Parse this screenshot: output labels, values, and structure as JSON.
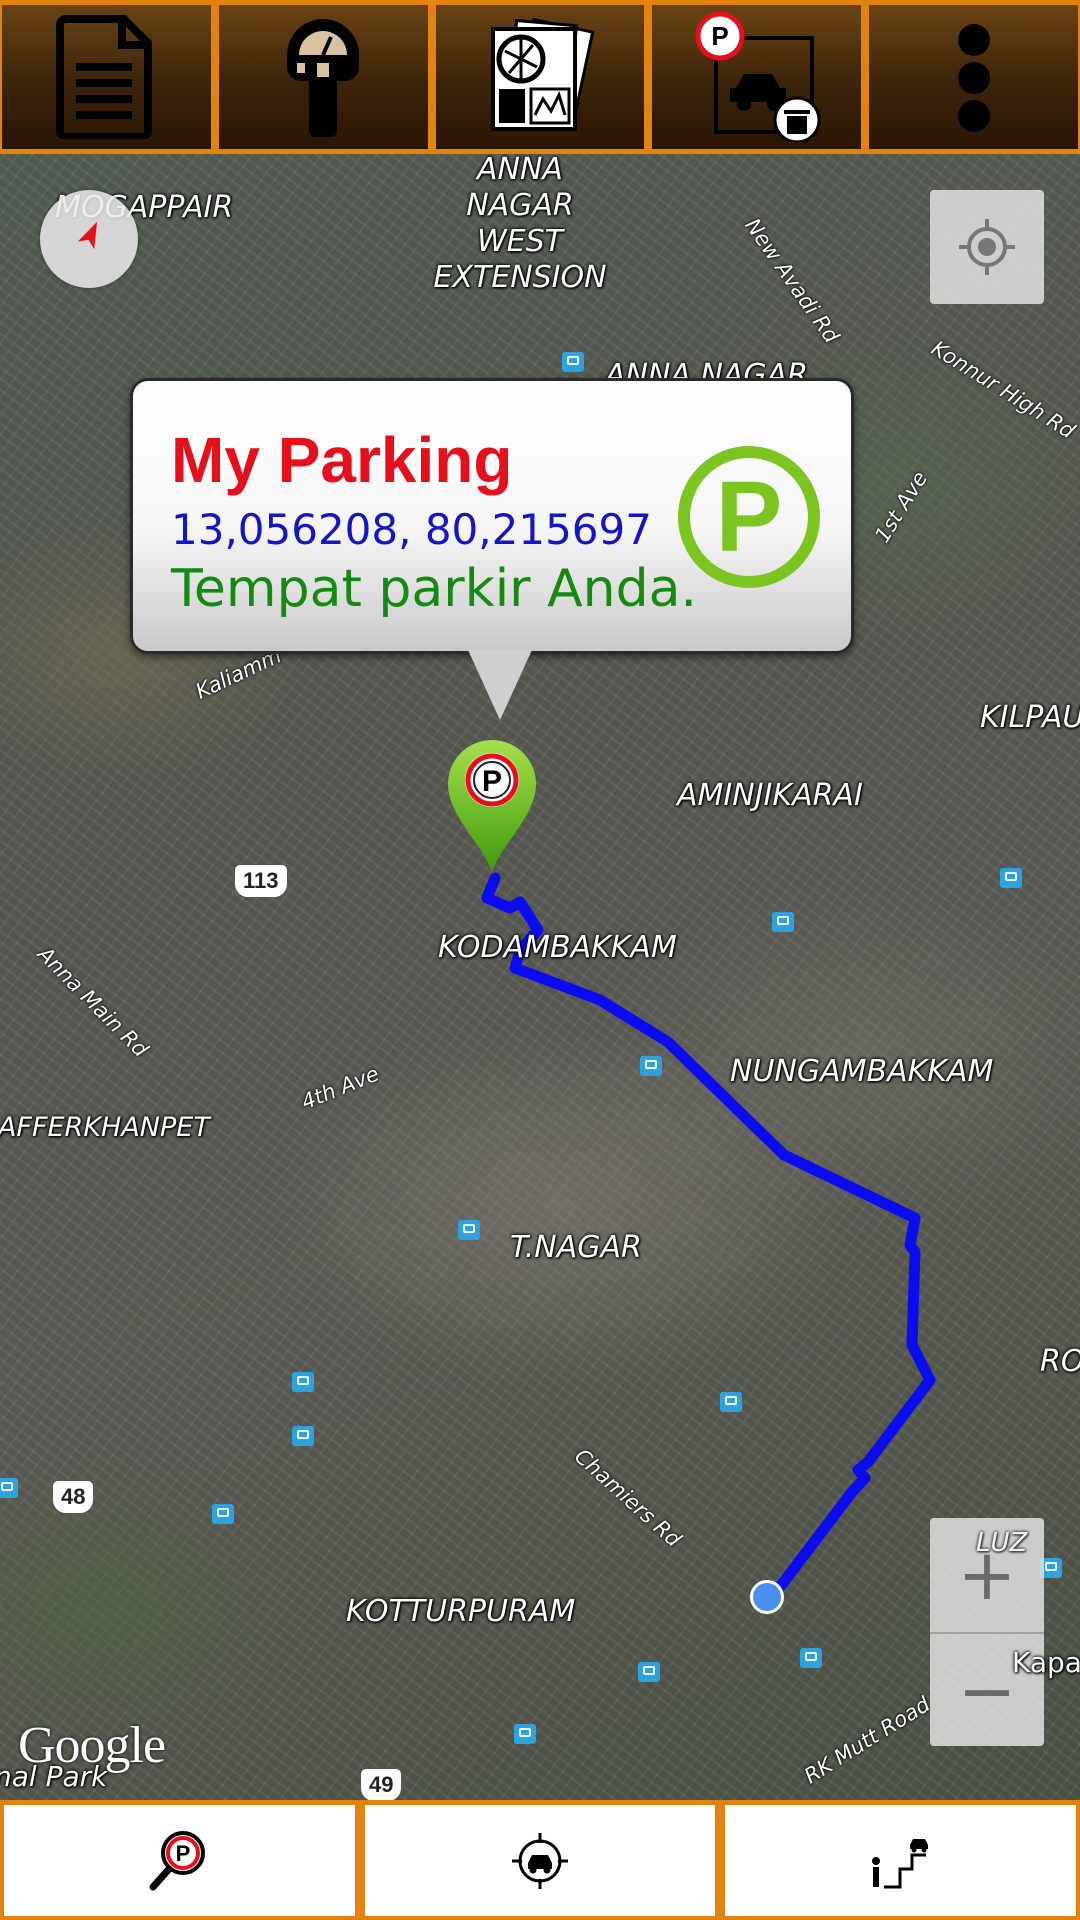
{
  "toolbar": {
    "items": [
      {
        "icon": "document-icon"
      },
      {
        "icon": "parking-meter-icon"
      },
      {
        "icon": "map-stack-icon"
      },
      {
        "icon": "delete-parking-icon"
      },
      {
        "icon": "overflow-menu-icon"
      }
    ]
  },
  "map": {
    "labels": {
      "mogappair": "MOGAPPAIR",
      "anna_nagar_west_ext": "ANNA NAGAR WEST EXTENSION",
      "anna_nagar": "ANNA NAGAR",
      "kilpauk": "KILPAU",
      "aminjikarai": "AMINJIKARAI",
      "kodambakkam": "KODAMBAKKAM",
      "nungambakkam": "NUNGAMBAKKAM",
      "jafferkhanpet": "JAFFERKHANPET",
      "t_nagar": "T.NAGAR",
      "kotturpuram": "KOTTURPURAM",
      "ro": "RO",
      "luz": "LUZ",
      "kapa": "Kapa",
      "national_park": "nal Park"
    },
    "roads": {
      "new_avadi_rd": "New Avadi Rd",
      "konnur_high_rd": "Konnur High Rd",
      "first_ave": "1st Ave",
      "kaliamman": "Kaliamm",
      "anna_main_rd": "Anna Main Rd",
      "fourth_ave": "4th Ave",
      "chamiers_rd": "Chamiers Rd",
      "rk_mutt_road": "RK Mutt Road"
    },
    "shields": {
      "r113": "113",
      "r48": "48",
      "r49": "49"
    },
    "attribution": "Google",
    "route_color": "#0b0bf0"
  },
  "marker": {
    "title": "My Parking",
    "coords": "13,056208, 80,215697",
    "description": "Tempat parkir Anda.",
    "icon_letter": "P"
  },
  "zoom": {
    "in_label": "+",
    "out_label": "−"
  },
  "bottom_bar": {
    "items": [
      {
        "icon": "find-parking-icon"
      },
      {
        "icon": "locate-car-icon"
      },
      {
        "icon": "walk-to-car-icon"
      }
    ]
  },
  "colors": {
    "accent": "#e3830f",
    "toolbar_brown": "#4a2c0c",
    "title_red": "#e5101c",
    "coords_blue": "#1414c8",
    "desc_green": "#158a12",
    "parking_green": "#7cc520"
  }
}
